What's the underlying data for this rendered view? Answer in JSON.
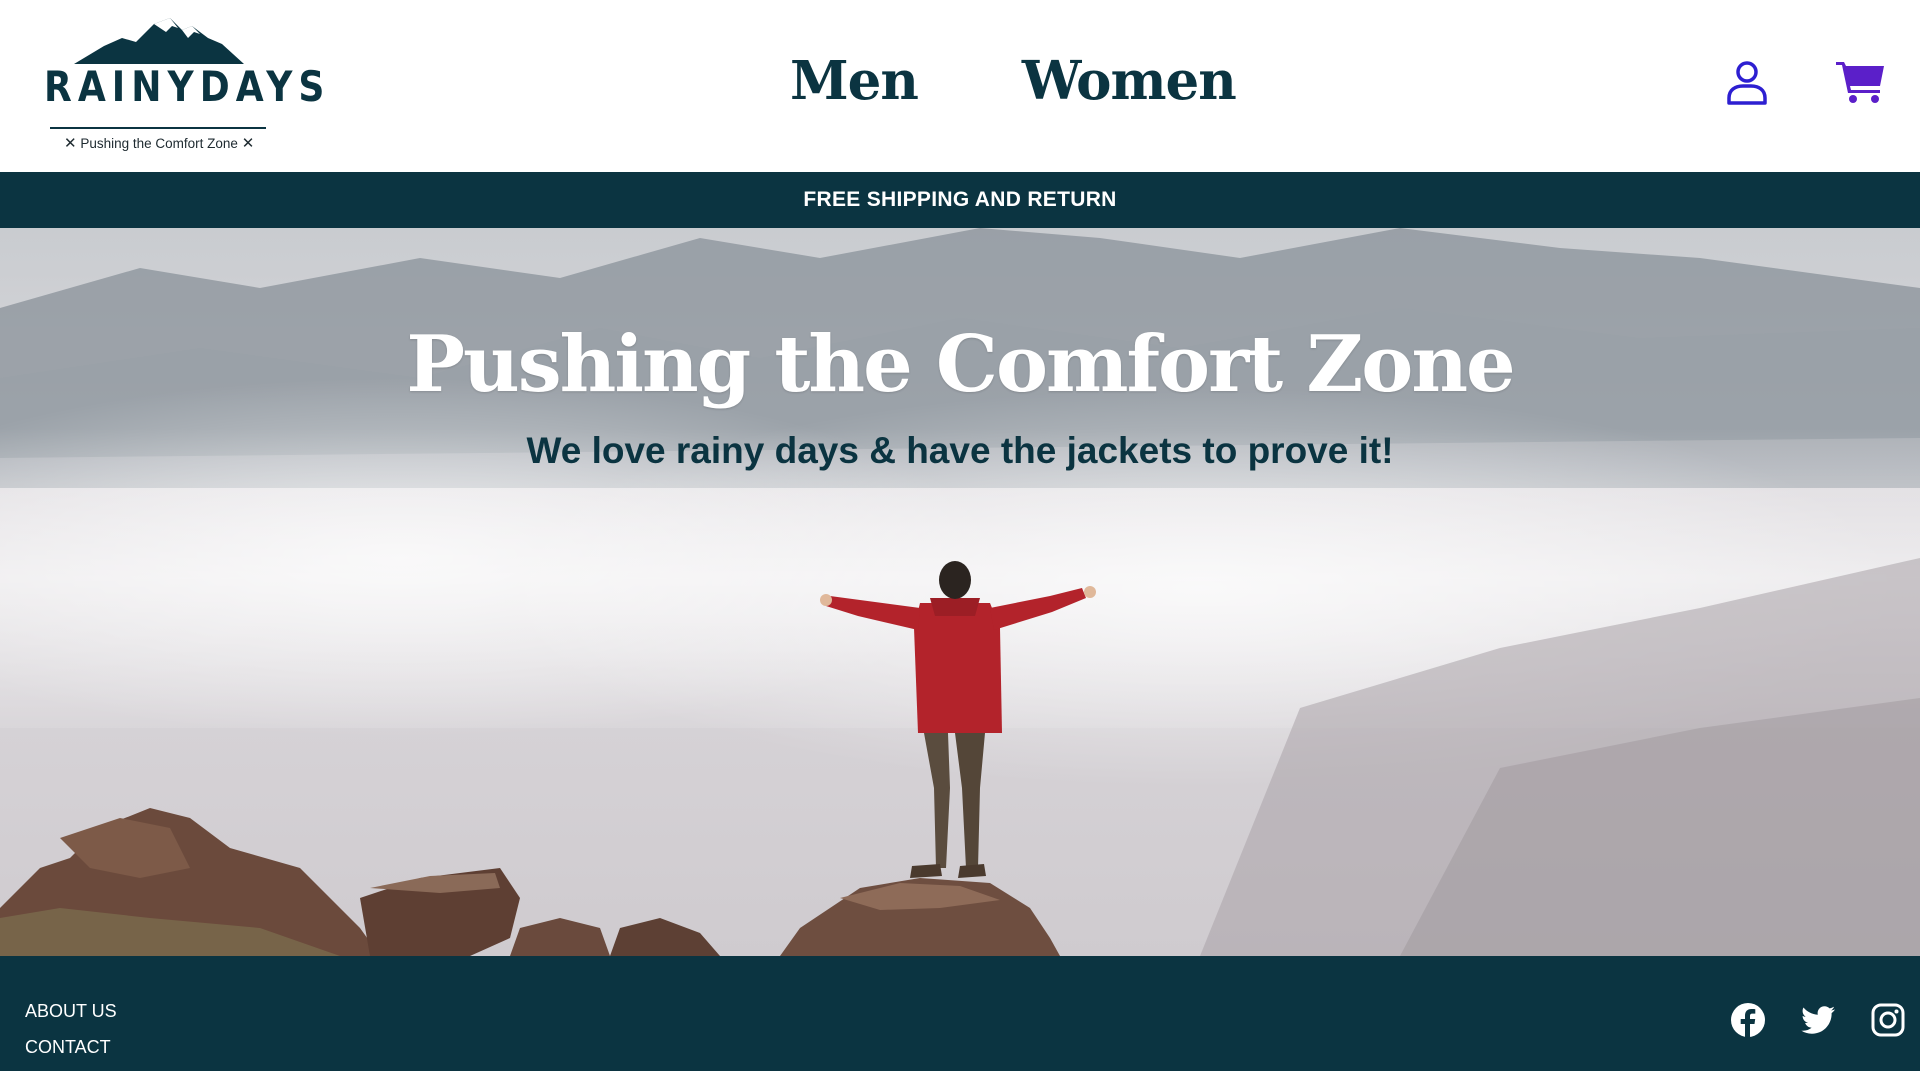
{
  "brand": {
    "name": "RAINYDAYS",
    "tagline": "Pushing the Comfort Zone",
    "tagline_mark": "✕",
    "logo_icon": "mountain-icon"
  },
  "nav": {
    "items": [
      {
        "label": "Men"
      },
      {
        "label": "Women"
      }
    ]
  },
  "header_icons": {
    "user": "user-icon",
    "cart": "cart-icon"
  },
  "promo": {
    "text": "FREE SHIPPING AND RETURN"
  },
  "hero": {
    "title": "Pushing the Comfort Zone",
    "subtitle": "We love rainy days & have the jackets to prove it!"
  },
  "footer": {
    "links": [
      {
        "label": "ABOUT US"
      },
      {
        "label": "CONTACT"
      }
    ],
    "social": [
      "facebook-icon",
      "twitter-icon",
      "instagram-icon"
    ]
  },
  "colors": {
    "brand_dark": "#0b3441",
    "icon_user": "#2d1fd1",
    "icon_cart": "#5b1fc9",
    "jacket": "#b3232b",
    "white": "#ffffff"
  }
}
